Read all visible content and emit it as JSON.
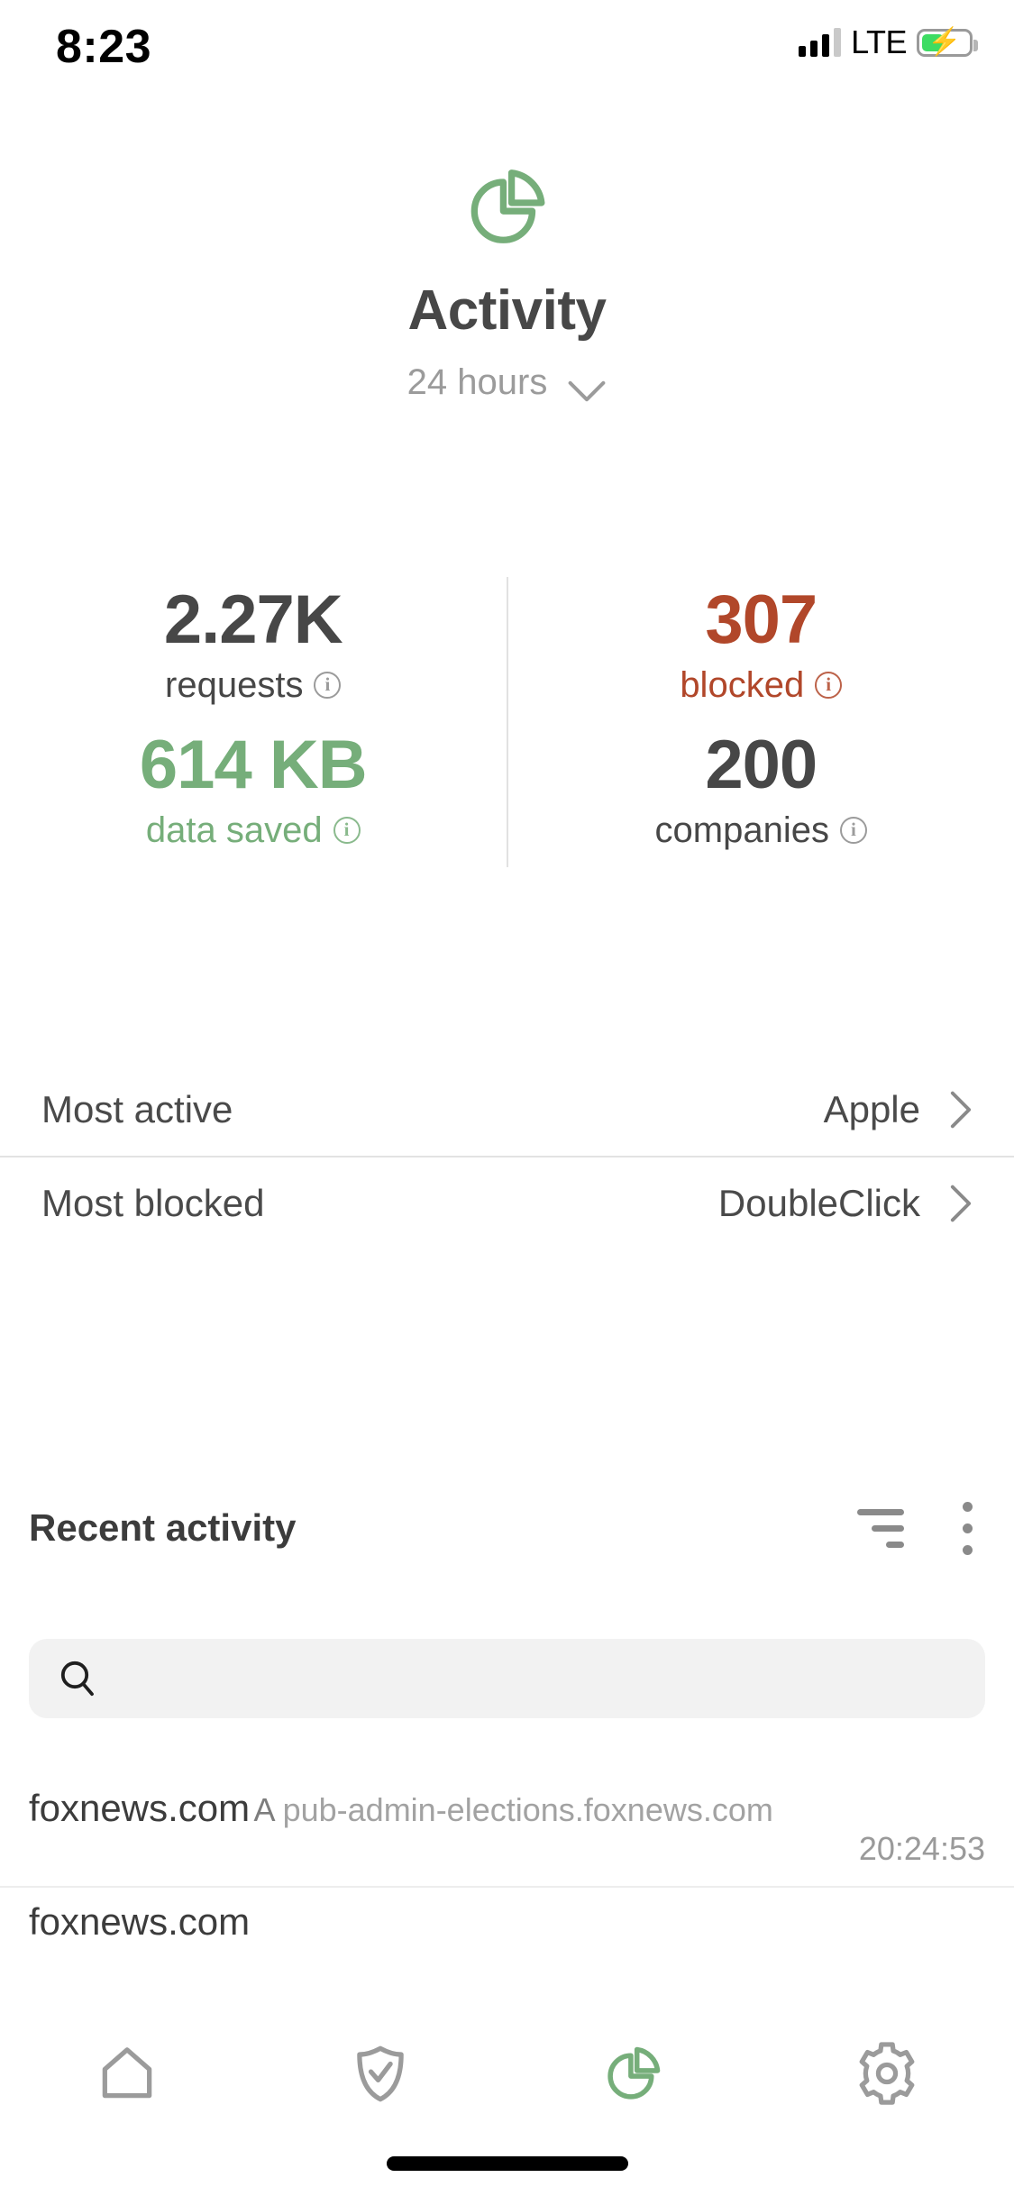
{
  "status_bar": {
    "time": "8:23",
    "network_type": "LTE",
    "signal_icon": "signal-bars-icon",
    "battery_icon": "battery-charging-icon"
  },
  "header": {
    "logo_icon": "pie-chart-icon",
    "title": "Activity",
    "period_label": "24 hours",
    "period_chevron_icon": "chevron-down-icon"
  },
  "stats": [
    {
      "value": "2.27K",
      "label": "requests",
      "color": "#474747",
      "info_icon": "info-icon"
    },
    {
      "value": "307",
      "label": "blocked",
      "color": "#b1472a",
      "info_icon": "info-icon"
    },
    {
      "value": "614 KB",
      "label": "data saved",
      "color": "#76ae7a",
      "info_icon": "info-icon"
    },
    {
      "value": "200",
      "label": "companies",
      "color": "#474747",
      "info_icon": "info-icon"
    }
  ],
  "summary_rows": [
    {
      "key": "Most active",
      "value": "Apple",
      "chevron_icon": "chevron-right-icon"
    },
    {
      "key": "Most blocked",
      "value": "DoubleClick",
      "chevron_icon": "chevron-right-icon"
    }
  ],
  "recent": {
    "title": "Recent activity",
    "filter_icon": "filter-sort-icon",
    "menu_icon": "more-vertical-icon",
    "search": {
      "icon": "search-icon",
      "value": "",
      "placeholder": ""
    },
    "entries": [
      {
        "domain": "foxnews.com",
        "query_type": "A",
        "query_host": "pub-admin-elections.foxnews.com",
        "time": "20:24:53"
      },
      {
        "domain": "foxnews.com",
        "query_type": "",
        "query_host": "",
        "time": ""
      }
    ]
  },
  "tabbar": {
    "active_index": 2,
    "active_color": "#76ae7a",
    "inactive_color": "#9b9b9b",
    "items": [
      {
        "name": "home",
        "icon": "home-icon"
      },
      {
        "name": "protect",
        "icon": "shield-check-icon"
      },
      {
        "name": "activity",
        "icon": "pie-chart-icon"
      },
      {
        "name": "settings",
        "icon": "gear-icon"
      }
    ]
  }
}
